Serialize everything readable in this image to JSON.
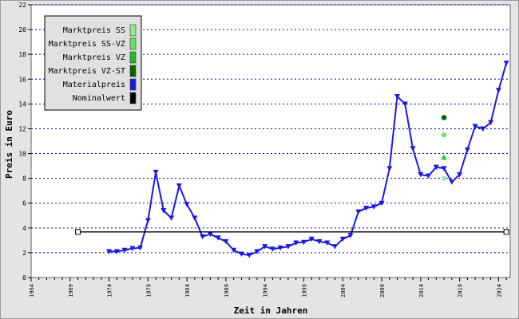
{
  "chart_data": {
    "type": "line",
    "xlabel": "Zeit in Jahren",
    "ylabel": "Preis in Euro",
    "xlim": [
      1964,
      2025.5
    ],
    "ylim": [
      0,
      22
    ],
    "x_ticks": [
      "1964",
      "1969",
      "1974",
      "1979",
      "1984",
      "1989",
      "1994",
      "1999",
      "2004",
      "2009",
      "2014",
      "2019",
      "2024"
    ],
    "y_ticks": [
      "0",
      "2",
      "4",
      "6",
      "8",
      "10",
      "12",
      "14",
      "16",
      "18",
      "20",
      "22"
    ],
    "grid": "horizontal-dotted",
    "legend_position": "top-left",
    "legend": [
      {
        "label": "Marktpreis SS",
        "color": "#90ee90"
      },
      {
        "label": "Marktpreis SS-VZ",
        "color": "#66e066"
      },
      {
        "label": "Marktpreis VZ",
        "color": "#22bb22"
      },
      {
        "label": "Marktpreis VZ-ST",
        "color": "#006400"
      },
      {
        "label": "Materialpreis",
        "color": "#1a1add"
      },
      {
        "label": "Nominalwert",
        "color": "#000000"
      }
    ],
    "series": [
      {
        "name": "Materialpreis",
        "color": "#1a1add",
        "marker": "triangle-down",
        "x": [
          1974,
          1975,
          1976,
          1977,
          1978,
          1979,
          1980,
          1981,
          1982,
          1983,
          1984,
          1985,
          1986,
          1987,
          1988,
          1989,
          1990,
          1991,
          1992,
          1993,
          1994,
          1995,
          1996,
          1997,
          1998,
          1999,
          2000,
          2001,
          2002,
          2003,
          2004,
          2005,
          2006,
          2007,
          2008,
          2009,
          2010,
          2011,
          2012,
          2013,
          2014,
          2015,
          2016,
          2017,
          2018,
          2019,
          2020,
          2021,
          2022,
          2023,
          2024,
          2025
        ],
        "y": [
          2.1,
          2.1,
          2.2,
          2.35,
          2.4,
          4.6,
          8.5,
          5.4,
          4.8,
          7.4,
          5.9,
          4.8,
          3.3,
          3.5,
          3.2,
          2.9,
          2.2,
          1.9,
          1.8,
          2.1,
          2.5,
          2.3,
          2.4,
          2.5,
          2.8,
          2.85,
          3.1,
          2.9,
          2.8,
          2.5,
          3.1,
          3.4,
          5.3,
          5.6,
          5.7,
          6.0,
          8.8,
          14.6,
          14.0,
          10.4,
          8.3,
          8.2,
          8.9,
          8.8,
          7.7,
          8.3,
          10.3,
          12.2,
          12.0,
          12.5,
          15.1,
          17.3
        ]
      },
      {
        "name": "Nominalwert",
        "color": "#000000",
        "marker": "square-open",
        "x": [
          1970,
          2025
        ],
        "y": [
          3.68,
          3.68
        ]
      },
      {
        "name": "Marktpreis SS",
        "color": "#90ee90",
        "marker": "dot",
        "x": [
          2017
        ],
        "y": [
          8.0
        ]
      },
      {
        "name": "Marktpreis SS-VZ",
        "color": "#66e066",
        "marker": "dot",
        "x": [
          2017
        ],
        "y": [
          11.5
        ]
      },
      {
        "name": "Marktpreis VZ",
        "color": "#22bb22",
        "marker": "triangle-up",
        "x": [
          2017
        ],
        "y": [
          9.7
        ]
      },
      {
        "name": "Marktpreis VZ-ST",
        "color": "#006400",
        "marker": "pentagon",
        "x": [
          2017
        ],
        "y": [
          12.9
        ]
      }
    ]
  }
}
